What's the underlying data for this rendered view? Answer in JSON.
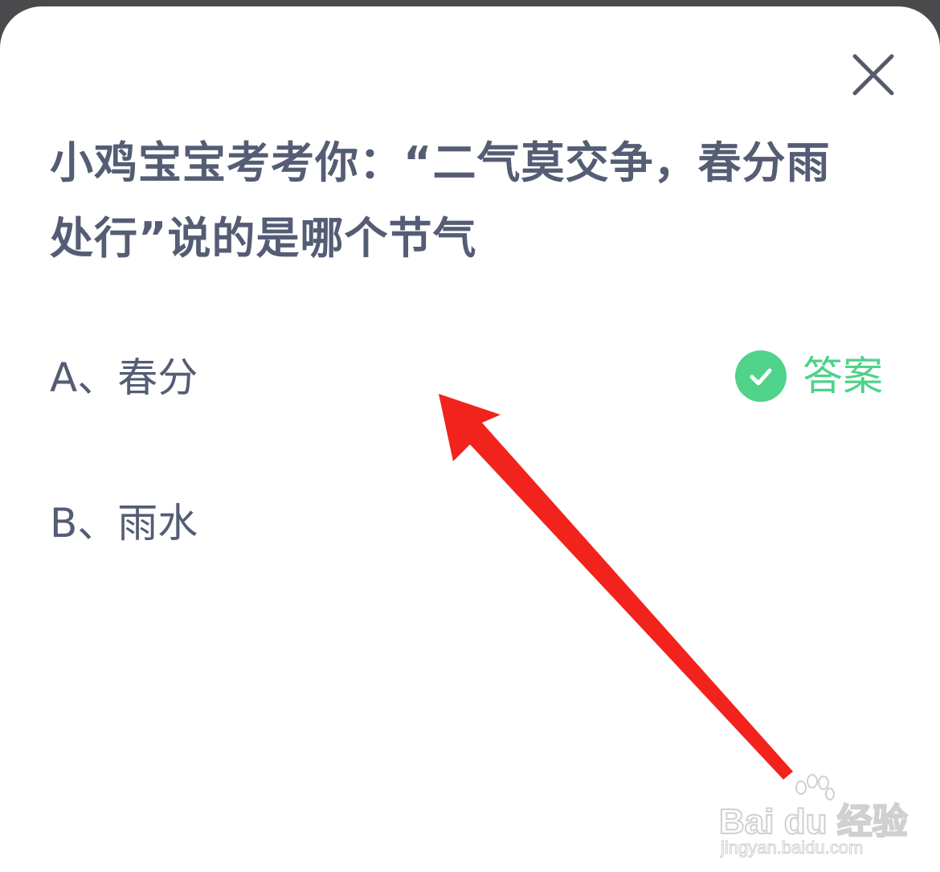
{
  "quiz": {
    "question": "小鸡宝宝考考你：“二气莫交争，春分雨处行”说的是哪个节气",
    "options": [
      {
        "label": "A、春分",
        "is_answer": true
      },
      {
        "label": "B、雨水",
        "is_answer": false
      }
    ],
    "answer_label": "答案",
    "close_icon": "close-icon",
    "check_icon": "check-circle-icon"
  },
  "colors": {
    "text": "#545d74",
    "accent": "#4fd28a",
    "annotation_arrow": "#f2231c",
    "backdrop": "#4a4a4c"
  },
  "watermark": {
    "brand": "Bai du 经验",
    "url": "jingyan.baidu.com"
  }
}
